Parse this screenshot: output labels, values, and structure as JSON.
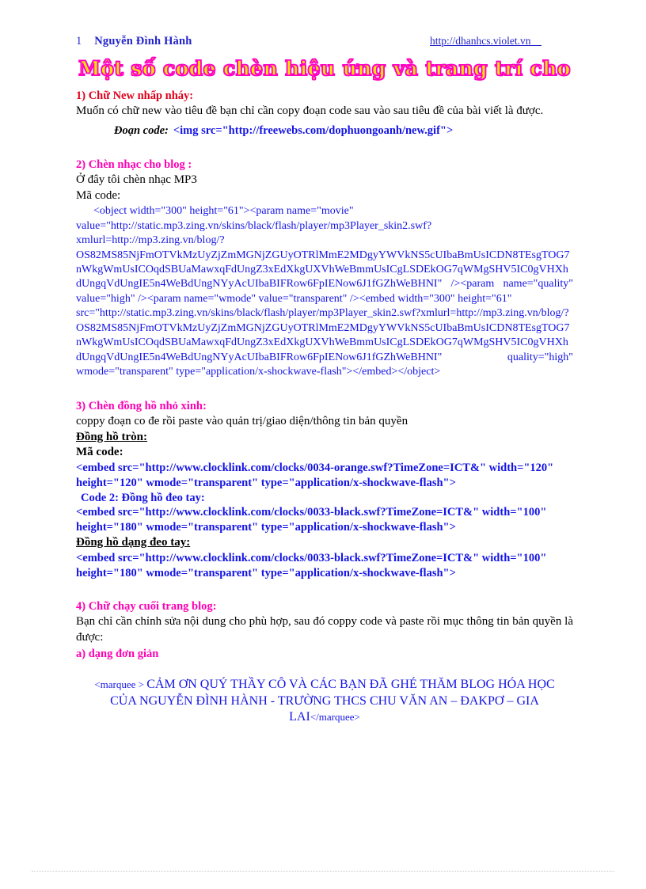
{
  "header": {
    "page_number": "1",
    "author": "Nguyễn Đình Hành",
    "url": "http://dhanhcs.violet.vn    "
  },
  "title": "Một số code chèn hiệu ứng và trang trí cho",
  "sections": [
    {
      "id": "s1",
      "heading": "1) Chữ New nhấp nháy:",
      "body": "Muốn có chữ new vào tiêu đề bạn chỉ cần copy đoạn code sau vào sau tiêu đề của bài viết là được.",
      "code_label": "Đoạn code:",
      "code": "<img src=\"http://freewebs.com/dophuongoanh/new.gif\">"
    },
    {
      "id": "s2",
      "heading": "2) Chèn nhạc cho blog :",
      "line1": "Ở đây tôi chèn nhạc MP3",
      "line2": "Mã code:",
      "code_first_line": "<object width=\"300\"  height=\"61\"><param  name=\"movie\"",
      "code_body": "value=\"http://static.mp3.zing.vn/skins/black/flash/player/mp3Player_skin2.swf?xmlurl=http://mp3.zing.vn/blog/?OS82MS85NjFmOTVkMzUyZjZmMGNjZGUyOTRlMmE2MDgyYWVkNS5cUIbaBmUsICDN8TEsgTOG7nWkgWmUsICOqdSBUaMawxqFdUngZ3xEdXkgUXVhWeBmmUsICgLSDEkOG7qWMgSHV5IC0gVHXhdUngqVdUngIE5n4WeBdUngNYyAcUIbaBIFRow6FpIENow6J1fGZhWeBHNI\"  /><param name=\"quality\"  value=\"high\"  /><param name=\"wmode\"  value=\"transparent\"   /><embed width=\"300\"  height=\"61\"",
      "code_body2": "src=\"http://static.mp3.zing.vn/skins/black/flash/player/mp3Player_skin2.swf?xmlurl=http://mp3.zing.vn/blog/?OS82MS85NjFmOTVkMzUyZjZmMGNjZGUyOTRlMmE2MDgyYWVkNS5cUIbaBmUsICDN8TEsgTOG7nWkgWmUsICOqdSBUaMawxqFdUngZ3xEdXkgUXVhWeBmmUsICgLSDEkOG7qWMgSHV5IC0gVHXhdUngqVdUngIE5n4WeBdUngNYyAcUIbaBIFRow6FpIENow6J1fGZhWeBHNI\"   quality=\"high\"   wmode=\"transparent\" type=\"application/x-shockwave-flash\"></embed></object>"
    },
    {
      "id": "s3",
      "heading": "3) Chèn đồng hồ nhỏ xinh:",
      "line1": "coppy đoạn co đe rồi paste vào quản trị/giao  diện/thông  tin bản quyền",
      "sub1": "Đồng hồ tròn:",
      "sub2": "Mã code:",
      "code1": "<embed src=\"http://www.clocklink.com/clocks/0034-orange.swf?TimeZone=ICT&\" width=\"120\"  height=\"120\" wmode=\"transparent\"  type=\"application/x-shockwave-flash\">",
      "code2_label": "Code 2:  Đồng hồ đeo tay:",
      "code2": "<embed src=\"http://www.clocklink.com/clocks/0033-black.swf?TimeZone=ICT&\" width=\"100\"  height=\"180\" wmode=\"transparent\"  type=\"application/x-shockwave-flash\">",
      "sub3": "Đồng hồ dạng đeo tay:",
      "code3": "<embed src=\"http://www.clocklink.com/clocks/0033-black.swf?TimeZone=ICT&\" width=\"100\"  height=\"180\" wmode=\"transparent\"  type=\"application/x-shockwave-flash\">"
    },
    {
      "id": "s4",
      "heading": "4) Chữ chạy cuối trang blog:",
      "body": "Bạn chỉ cần chỉnh sửa nội dung cho phù hợp, sau đó coppy code và paste rồi mục thông tin bản quyền là được:",
      "subheading": "a) dạng đơn giản",
      "marquee_open": "<marquee  > ",
      "marquee_text": "CẢM ƠN QUÝ THẦY CÔ VÀ CÁC BẠN ĐÃ GHÉ THĂM BLOG HÓA HỌC CỦA NGUYỄN ĐÌNH HÀNH - TRƯỜNG THCS CHU VĂN AN – ĐAKPƠ – GIA LAI",
      "marquee_close": "</marquee>"
    }
  ],
  "colors": {
    "header_blue": "#2222cc",
    "code_blue": "#1414e6",
    "heading_red": "#e0001b",
    "heading_magenta": "#ff00b4",
    "title_fill": "#ffe600",
    "title_outline": "#ff00c8"
  }
}
